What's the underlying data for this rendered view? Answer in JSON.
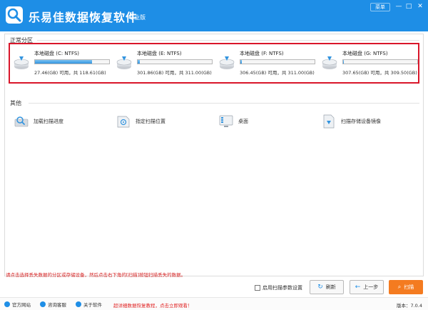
{
  "app": {
    "title": "乐易佳数据恢复软件",
    "edition": "专业版",
    "menu_label": "菜单",
    "colors": {
      "titlebar": "#1e8ee6",
      "accent": "#f47b20",
      "highlight_border": "#d9162a"
    }
  },
  "sections": {
    "partitions_title": "正常分区",
    "other_title": "其他"
  },
  "partitions": [
    {
      "name": "本地磁盘 (C: NTFS)",
      "usage": "27.46(GB) 可用，共 118.61(GB)",
      "used_fraction": 0.77
    },
    {
      "name": "本地磁盘 (E: NTFS)",
      "usage": "301.86(GB) 可用，共 311.00(GB)",
      "used_fraction": 0.03
    },
    {
      "name": "本地磁盘 (F: NTFS)",
      "usage": "306.45(GB) 可用，共 311.00(GB)",
      "used_fraction": 0.015
    },
    {
      "name": "本地磁盘 (G: NTFS)",
      "usage": "307.65(GB) 可用，共 309.50(GB)",
      "used_fraction": 0.006
    }
  ],
  "tools": [
    {
      "label": "加载扫描进度",
      "icon": "load-progress-icon"
    },
    {
      "label": "指定扫描位置",
      "icon": "specify-location-icon"
    },
    {
      "label": "桌面",
      "icon": "desktop-icon"
    },
    {
      "label": "扫描存储设备镜像",
      "icon": "scan-image-icon"
    }
  ],
  "hint": "请点击选择丢失数据的分区或存储设备，然后点击右下角的[扫描]按钮扫描丢失的数据。",
  "controls": {
    "checkbox_label": "启用扫描参数设置",
    "refresh_label": "刷新",
    "prev_label": "上一步",
    "scan_label": "扫描"
  },
  "footer": {
    "website": "官方网站",
    "support": "咨询客服",
    "about": "关于软件",
    "promo": "超详细数据恢复教程，点击立即观看！",
    "version": "版本：7.0.4"
  }
}
